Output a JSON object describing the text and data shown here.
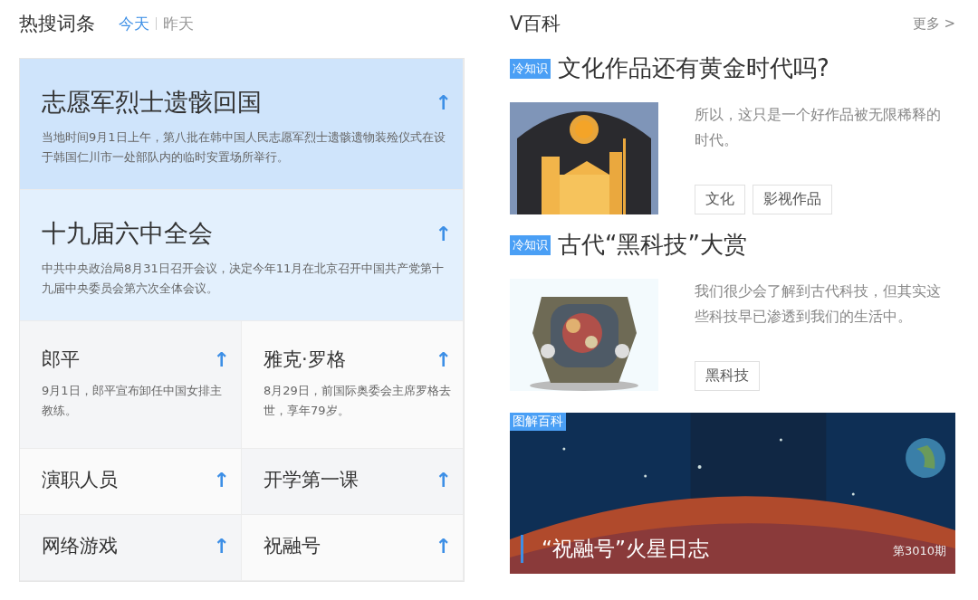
{
  "hot": {
    "title": "热搜词条",
    "tabs": [
      {
        "label": "今天",
        "selected": true
      },
      {
        "label": "昨天",
        "selected": false
      }
    ],
    "items": [
      {
        "kind": "featured",
        "title": "志愿军烈士遗骸回国",
        "desc": "当地时间9月1日上午，第八批在韩中国人民志愿军烈士遗骸遗物装殓仪式在设于韩国仁川市一处部队内的临时安置场所举行。",
        "trend": "↑"
      },
      {
        "kind": "featured",
        "title": "十九届六中全会",
        "desc": "中共中央政治局8月31日召开会议，决定今年11月在北京召开中国共产党第十九届中央委员会第六次全体会议。",
        "trend": "↑"
      },
      {
        "kind": "half",
        "title": "郎平",
        "desc": "9月1日，郎平宣布卸任中国女排主教练。",
        "trend": "↑"
      },
      {
        "kind": "half",
        "title": "雅克·罗格",
        "desc": "8月29日，前国际奥委会主席罗格去世，享年79岁。",
        "trend": "↑"
      },
      {
        "kind": "half",
        "title": "演职人员",
        "trend": "↑"
      },
      {
        "kind": "half",
        "title": "开学第一课",
        "trend": "↑"
      },
      {
        "kind": "half",
        "title": "网络游戏",
        "trend": "↑"
      },
      {
        "kind": "half",
        "title": "祝融号",
        "trend": "↑"
      }
    ]
  },
  "baike": {
    "title": "V百科",
    "more": "更多 >",
    "articles": [
      {
        "badge": "冷知识",
        "title": "文化作品还有黄金时代吗?",
        "desc": "所以，这只是一个好作品被无限稀释的时代。",
        "tags": [
          "文化",
          "影视作品"
        ]
      },
      {
        "badge": "冷知识",
        "title": "古代“黑科技”大赏",
        "desc": "我们很少会了解到古代科技，但其实这些科技早已渗透到我们的生活中。",
        "tags": [
          "黑科技"
        ]
      }
    ],
    "banner": {
      "badge": "图解百科",
      "title": "“祝融号”火星日志",
      "issue": "第3010期"
    }
  }
}
